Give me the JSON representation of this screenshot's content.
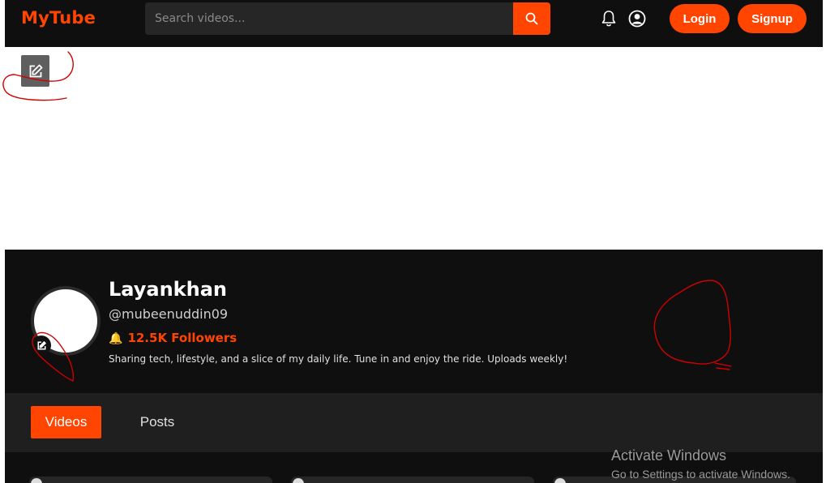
{
  "brand": {
    "logo": "MyTube",
    "accent": "#ff4500"
  },
  "navbar": {
    "search": {
      "placeholder": "Search videos...",
      "value": ""
    },
    "login_label": "Login",
    "signup_label": "Signup",
    "icons": [
      "search-icon",
      "bell-icon",
      "user-circle-icon"
    ]
  },
  "profile": {
    "name": "Layankhan",
    "handle": "@mubeenuddin09",
    "followers": "12.5K Followers",
    "bio": "Sharing tech, lifestyle, and a slice of my daily life. Tune in and enjoy the ride. Uploads weekly!"
  },
  "tabs": [
    {
      "label": "Videos",
      "active": true
    },
    {
      "label": "Posts",
      "active": false
    }
  ],
  "windows_watermark": {
    "title": "Activate Windows",
    "subtitle": "Go to Settings to activate Windows."
  },
  "annotation_color": "#d00000"
}
